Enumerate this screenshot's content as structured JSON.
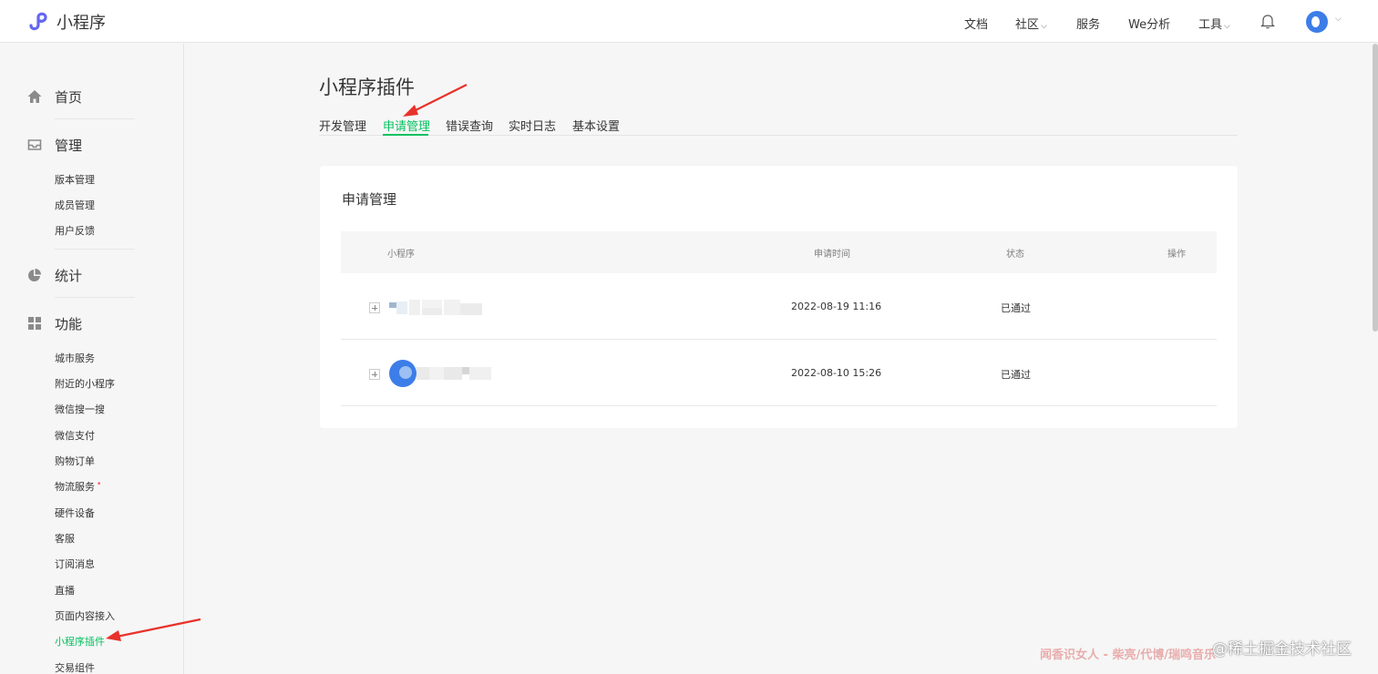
{
  "header": {
    "brand": "小程序",
    "nav": [
      {
        "label": "文档",
        "dropdown": false
      },
      {
        "label": "社区",
        "dropdown": true
      },
      {
        "label": "服务",
        "dropdown": false
      },
      {
        "label": "We分析",
        "dropdown": false
      },
      {
        "label": "工具",
        "dropdown": true
      }
    ],
    "chevron": "⌵"
  },
  "sidebar": {
    "groups": [
      {
        "label": "首页",
        "icon": "home-icon"
      },
      {
        "label": "管理",
        "icon": "inbox-icon",
        "items": [
          "版本管理",
          "成员管理",
          "用户反馈"
        ]
      },
      {
        "label": "统计",
        "icon": "pie-chart-icon"
      },
      {
        "label": "功能",
        "icon": "grid-icon",
        "items": [
          "城市服务",
          "附近的小程序",
          "微信搜一搜",
          "微信支付",
          "购物订单",
          "物流服务",
          "硬件设备",
          "客服",
          "订阅消息",
          "直播",
          "页面内容接入",
          "小程序插件",
          "交易组件"
        ]
      }
    ],
    "active_item": "小程序插件",
    "new_dot": "•"
  },
  "main": {
    "title": "小程序插件",
    "tabs": [
      "开发管理",
      "申请管理",
      "错误查询",
      "实时日志",
      "基本设置"
    ],
    "active_tab": "申请管理",
    "card": {
      "title": "申请管理",
      "columns": [
        "小程序",
        "申请时间",
        "状态",
        "操作"
      ],
      "rows": [
        {
          "time": "2022-08-19 11:16",
          "status": "已通过"
        },
        {
          "time": "2022-08-10 15:26",
          "status": "已通过"
        }
      ]
    }
  },
  "watermark": {
    "text1": "闻香识女人 - 柴亮/代博/瑞鸣音乐",
    "text2": "@稀土掘金技术社区"
  },
  "colors": {
    "accent": "#07c160",
    "arrow": "#e8322b"
  }
}
